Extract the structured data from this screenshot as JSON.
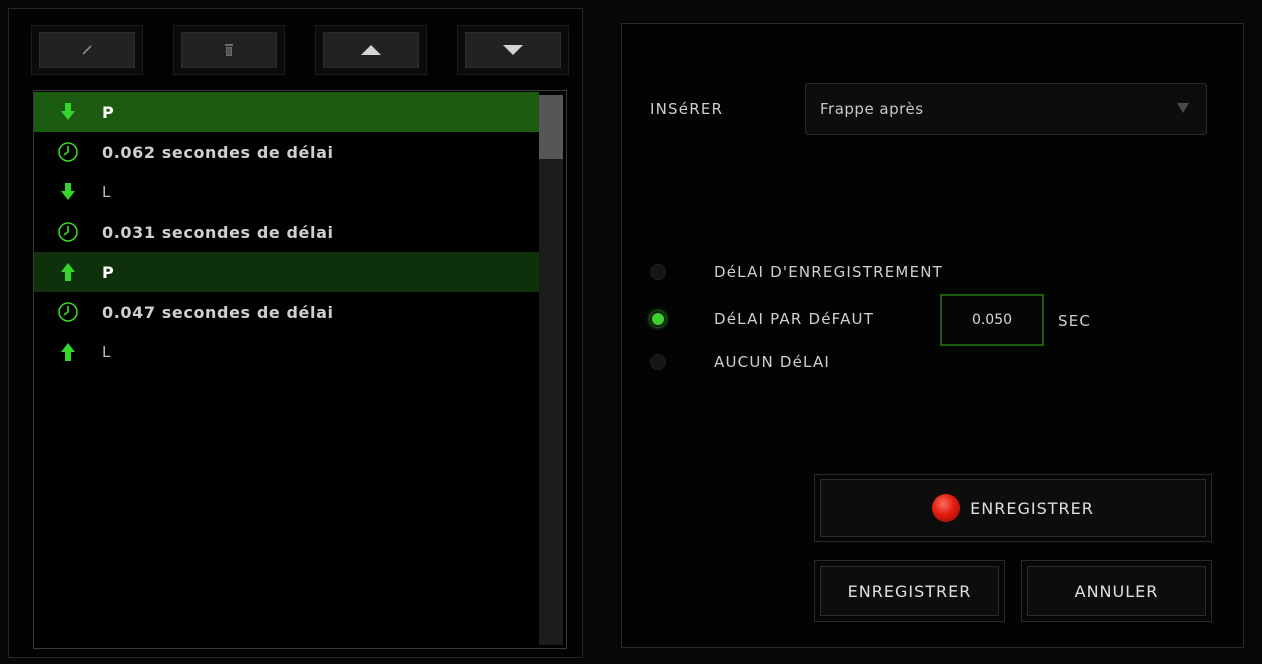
{
  "toolbar": {
    "edit_icon": "pencil-icon",
    "delete_icon": "trash-icon",
    "up_icon": "arrow-up-icon",
    "down_icon": "arrow-down-icon"
  },
  "macro_list": [
    {
      "icon": "key-down-icon",
      "text": "P",
      "style": "selected-green"
    },
    {
      "icon": "clock-icon",
      "text": "0.062 secondes de délai",
      "style": ""
    },
    {
      "icon": "key-down-icon",
      "text": "L",
      "style": "thin"
    },
    {
      "icon": "clock-icon",
      "text": "0.031 secondes de délai",
      "style": ""
    },
    {
      "icon": "key-up-icon",
      "text": "P",
      "style": "selected-dark"
    },
    {
      "icon": "clock-icon",
      "text": "0.047 secondes de délai",
      "style": ""
    },
    {
      "icon": "key-up-icon",
      "text": "L",
      "style": "thin"
    }
  ],
  "insert": {
    "label": "INSéRER",
    "value": "Frappe après"
  },
  "delay_options": {
    "recording": "DéLAI D'ENREGISTREMENT",
    "default": "DéLAI PAR DéFAUT",
    "none": "AUCUN DéLAI",
    "default_value": "0.050",
    "unit": "SEC",
    "selected": "default"
  },
  "buttons": {
    "record": "ENREGISTRER",
    "save": "ENREGISTRER",
    "cancel": "ANNULER"
  },
  "colors": {
    "accent_green": "#3cd22e",
    "row_selected": "#1b5c10",
    "record_red": "#e21b10"
  }
}
